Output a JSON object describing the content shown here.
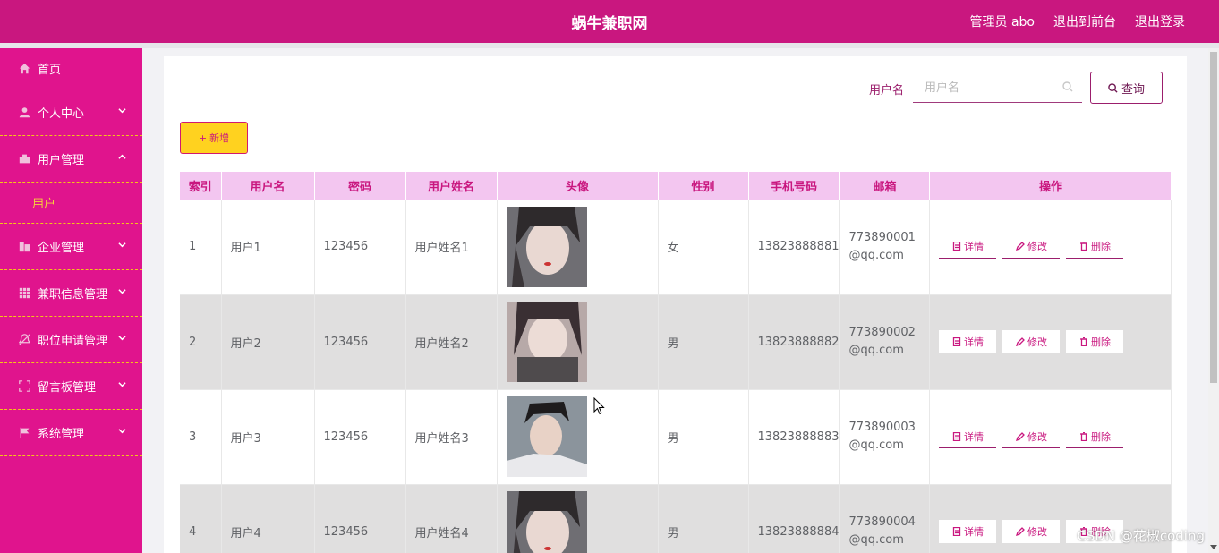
{
  "header": {
    "title": "蜗牛兼职网",
    "admin_label": "管理员 abo",
    "back_label": "退出到前台",
    "logout_label": "退出登录"
  },
  "sidebar": {
    "items": [
      {
        "label": "首页",
        "icon": "home-icon"
      },
      {
        "label": "个人中心",
        "icon": "user-icon"
      },
      {
        "label": "用户管理",
        "icon": "briefcase-icon",
        "expanded": true
      },
      {
        "label": "企业管理",
        "icon": "building-icon"
      },
      {
        "label": "兼职信息管理",
        "icon": "grid-icon"
      },
      {
        "label": "职位申请管理",
        "icon": "bell-off-icon"
      },
      {
        "label": "留言板管理",
        "icon": "frame-icon"
      },
      {
        "label": "系统管理",
        "icon": "flag-icon"
      }
    ],
    "submenu": {
      "label": "用户"
    }
  },
  "search": {
    "label": "用户名",
    "placeholder": "用户名",
    "query_label": "查询"
  },
  "actions": {
    "add_label": "新增"
  },
  "table": {
    "headers": [
      "索引",
      "用户名",
      "密码",
      "用户姓名",
      "头像",
      "性别",
      "手机号码",
      "邮箱",
      "操作"
    ],
    "rows": [
      {
        "index": "1",
        "username": "用户1",
        "password": "123456",
        "name": "用户姓名1",
        "gender": "女",
        "phone": "13823888881",
        "email": "773890001@qq.com"
      },
      {
        "index": "2",
        "username": "用户2",
        "password": "123456",
        "name": "用户姓名2",
        "gender": "男",
        "phone": "13823888882",
        "email": "773890002@qq.com"
      },
      {
        "index": "3",
        "username": "用户3",
        "password": "123456",
        "name": "用户姓名3",
        "gender": "男",
        "phone": "13823888883",
        "email": "773890003@qq.com"
      },
      {
        "index": "4",
        "username": "用户4",
        "password": "123456",
        "name": "用户姓名4",
        "gender": "男",
        "phone": "13823888884",
        "email": "773890004@qq.com"
      }
    ],
    "ops": {
      "detail": "详情",
      "edit": "修改",
      "delete": "删除"
    }
  },
  "watermark": "CSDN @花椒coding",
  "colors": {
    "header": "#c9177f",
    "sidebar": "#e0148d",
    "accent_yellow": "#ffd21f",
    "table_header": "#f3c6f0"
  }
}
